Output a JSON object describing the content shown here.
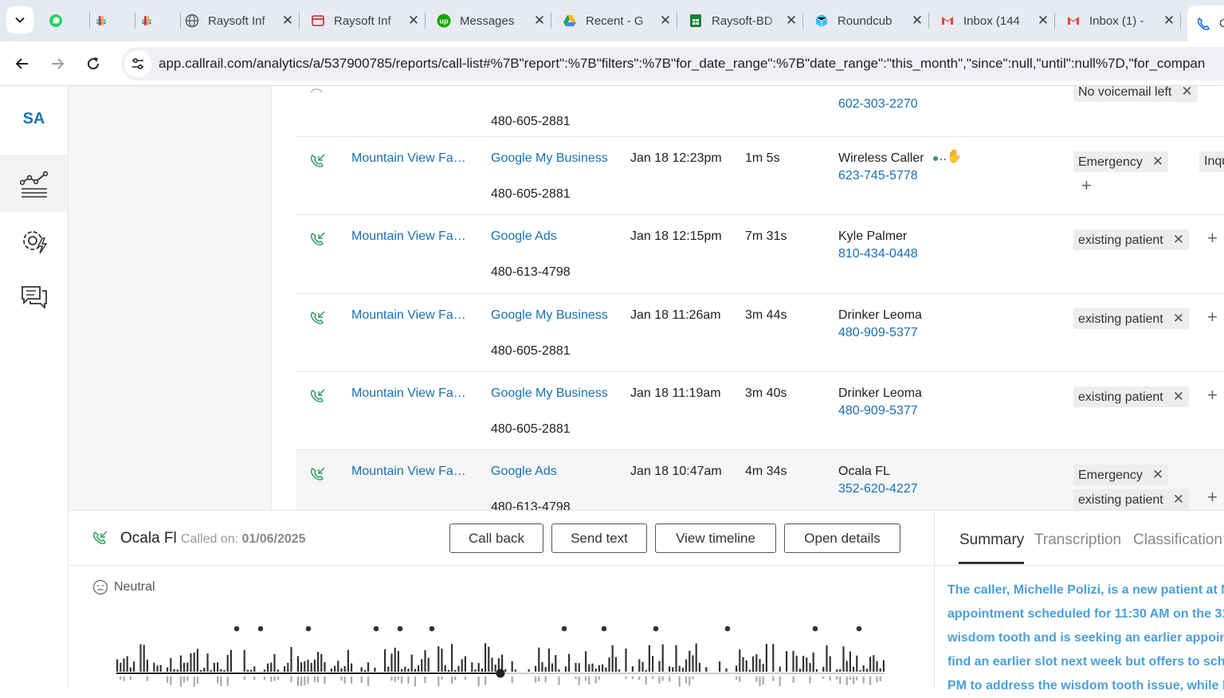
{
  "browser": {
    "tabs": [
      {
        "title": "",
        "icon": "whatsapp-icon",
        "color": "#25D366"
      },
      {
        "title": "",
        "icon": "slack-icon",
        "color": "#4A154B"
      },
      {
        "title": "",
        "icon": "slack-icon",
        "color": "#4A154B"
      },
      {
        "title": "Raysoft Inf",
        "icon": "globe-icon",
        "color": "#5f6368"
      },
      {
        "title": "Raysoft Inf",
        "icon": "raysoft-icon",
        "color": "#c62828"
      },
      {
        "title": "Messages",
        "icon": "upwork-icon",
        "color": "#14a800"
      },
      {
        "title": "Recent - G",
        "icon": "google-drive-icon",
        "color": "#1ea362"
      },
      {
        "title": "Raysoft-BD",
        "icon": "google-sheets-icon",
        "color": "#188038"
      },
      {
        "title": "Roundcub",
        "icon": "roundcube-icon",
        "color": "#37beff"
      },
      {
        "title": "Inbox (144",
        "icon": "gmail-icon",
        "color": "#ea4335"
      },
      {
        "title": "Inbox (1) -",
        "icon": "gmail-icon",
        "color": "#ea4335"
      },
      {
        "title": "C",
        "icon": "phone-icon",
        "color": "#1a73e8"
      }
    ],
    "url": "app.callrail.com/analytics/a/537900785/reports/call-list#%7B\"report\":%7B\"filters\":%7B\"for_date_range\":%7B\"date_range\":\"this_month\",\"since\":null,\"until\":null%7D,\"for_compan"
  },
  "rail": {
    "account_initials": "SA",
    "items": [
      "analytics-icon",
      "settings-automation-icon",
      "conversations-icon"
    ]
  },
  "calls": {
    "partial_top": {
      "number": "480-605-2881",
      "phone": "602-303-2270",
      "tag": "No voicemail left"
    },
    "rows": [
      {
        "company": "Mountain View Fa…",
        "source": "Google My Business",
        "number": "480-605-2881",
        "date": "Jan 18 12:23pm",
        "duration": "1m 5s",
        "caller": "Wireless Caller",
        "phone": "623-745-5778",
        "tags": [
          "Emergency",
          "Inquiry"
        ]
      },
      {
        "company": "Mountain View Fa…",
        "source": "Google Ads",
        "number": "480-613-4798",
        "date": "Jan 18 12:15pm",
        "duration": "7m 31s",
        "caller": "Kyle Palmer",
        "phone": "810-434-0448",
        "tags": [
          "existing patient"
        ]
      },
      {
        "company": "Mountain View Fa…",
        "source": "Google My Business",
        "number": "480-605-2881",
        "date": "Jan 18 11:26am",
        "duration": "3m 44s",
        "caller": "Drinker Leoma",
        "phone": "480-909-5377",
        "tags": [
          "existing patient"
        ]
      },
      {
        "company": "Mountain View Fa…",
        "source": "Google My Business",
        "number": "480-605-2881",
        "date": "Jan 18 11:19am",
        "duration": "3m 40s",
        "caller": "Drinker Leoma",
        "phone": "480-909-5377",
        "tags": [
          "existing patient"
        ]
      },
      {
        "company": "Mountain View Fa…",
        "source": "Google Ads",
        "number": "480-613-4798",
        "date": "Jan 18 10:47am",
        "duration": "4m 34s",
        "caller": "Ocala FL",
        "phone": "352-620-4227",
        "tags": [
          "Emergency",
          "existing patient"
        ]
      }
    ]
  },
  "detail": {
    "caller_name": "Ocala Fl",
    "called_on_label": "Called on:",
    "called_on_date": "01/06/2025",
    "buttons": {
      "call_back": "Call back",
      "send_text": "Send text",
      "view_timeline": "View timeline",
      "open_details": "Open details"
    },
    "sentiment": "Neutral",
    "tabs": [
      "Summary",
      "Transcription",
      "Classification"
    ],
    "active_tab": "Summary",
    "summary_lines": [
      "The caller, Michelle Polizi, is a new patient at M",
      "appointment scheduled for 11:30 AM on the 31",
      "wisdom tooth and is seeking an earlier appoint",
      "find an earlier slot next week but offers to sche",
      "PM to address the wisdom tooth issue, while k"
    ],
    "playback_progress": 0.5
  }
}
